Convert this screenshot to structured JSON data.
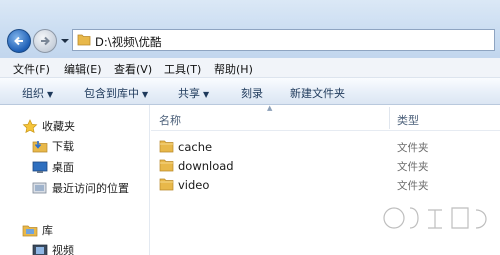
{
  "address": {
    "path": "D:\\视频\\优酷"
  },
  "menu": [
    "文件(F)",
    "编辑(E)",
    "查看(V)",
    "工具(T)",
    "帮助(H)"
  ],
  "toolbar": {
    "organize": "组织",
    "include_in_library": "包含到库中",
    "share": "共享",
    "burn": "刻录",
    "new_folder": "新建文件夹"
  },
  "nav": {
    "favorites": "收藏夹",
    "downloads": "下载",
    "desktop": "桌面",
    "recent": "最近访问的位置",
    "libraries": "库",
    "videos": "视频"
  },
  "columns": {
    "name": "名称",
    "type": "类型"
  },
  "files": [
    {
      "name": "cache",
      "type": "文件夹"
    },
    {
      "name": "download",
      "type": "文件夹"
    },
    {
      "name": "video",
      "type": "文件夹"
    }
  ],
  "colors": {
    "folder": "#e8b84a",
    "accent": "#1e5fb6"
  }
}
